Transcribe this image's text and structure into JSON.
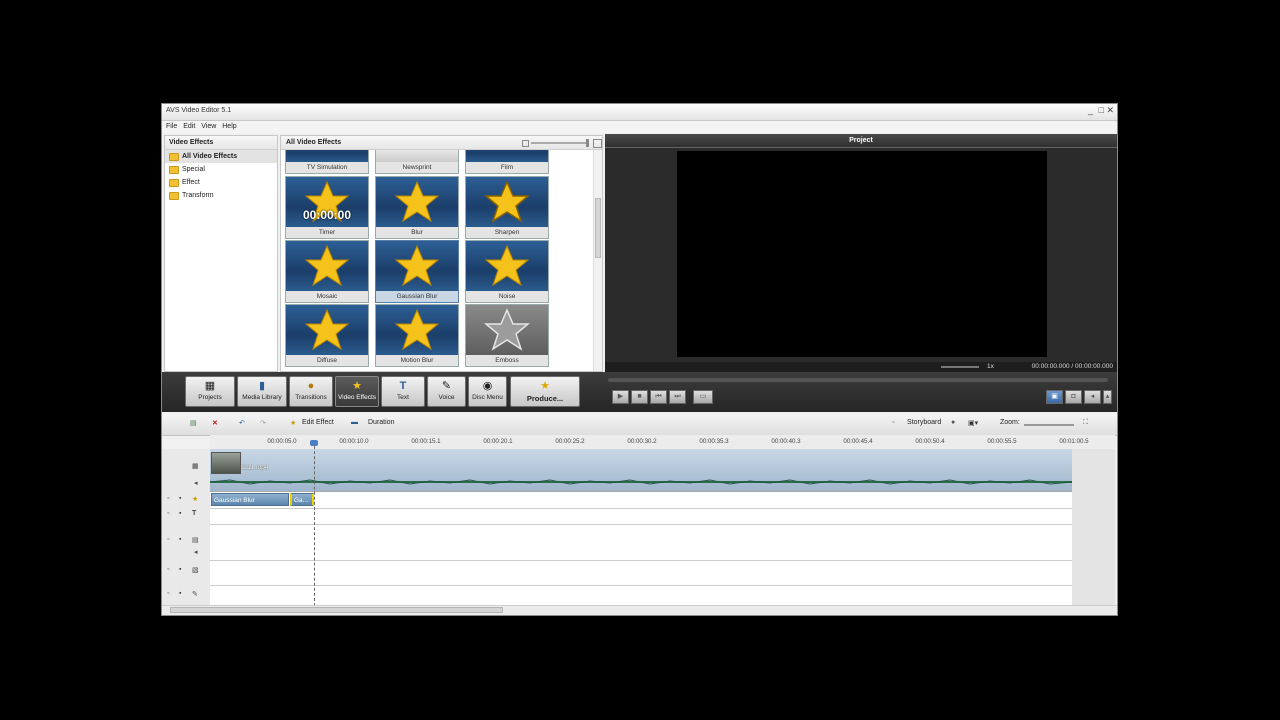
{
  "window": {
    "title": "AVS Video Editor 5.1",
    "controls": [
      "_",
      "□",
      "✕"
    ]
  },
  "menu": [
    "File",
    "Edit",
    "View",
    "Help"
  ],
  "tree": {
    "header": "Video Effects",
    "items": [
      {
        "label": "All Video Effects",
        "selected": true
      },
      {
        "label": "Special"
      },
      {
        "label": "Effect"
      },
      {
        "label": "Transform"
      }
    ]
  },
  "grid": {
    "header": "All Video Effects",
    "effects": [
      {
        "label": "TV Simulation"
      },
      {
        "label": "Newsprint"
      },
      {
        "label": "Film"
      },
      {
        "label": "Timer",
        "overlay": "00:00:00"
      },
      {
        "label": "Blur"
      },
      {
        "label": "Sharpen"
      },
      {
        "label": "Mosaic"
      },
      {
        "label": "Gaussian Blur",
        "selected": true
      },
      {
        "label": "Noise"
      },
      {
        "label": "Diffuse"
      },
      {
        "label": "Motion Blur"
      },
      {
        "label": "Emboss"
      }
    ]
  },
  "preview": {
    "title": "Project",
    "speed": "1x",
    "time": "00:00:00.000 / 00:00:00.000"
  },
  "toolbar": {
    "buttons": [
      {
        "label": "Projects",
        "icon": "projects-icon"
      },
      {
        "label": "Media Library",
        "icon": "media-library-icon"
      },
      {
        "label": "Transitions",
        "icon": "transitions-icon"
      },
      {
        "label": "Video Effects",
        "icon": "video-effects-icon",
        "active": true
      },
      {
        "label": "Text",
        "icon": "text-icon"
      },
      {
        "label": "Voice",
        "icon": "voice-icon"
      },
      {
        "label": "Disc Menu",
        "icon": "disc-menu-icon"
      },
      {
        "label": "Produce...",
        "icon": "produce-icon"
      }
    ]
  },
  "timeline": {
    "edit_effect": "Edit Effect",
    "duration": "Duration",
    "storyboard": "Storyboard",
    "zoom": "Zoom:",
    "ruler": [
      "00:00:05.0",
      "00:00:10.0",
      "00:00:15.1",
      "00:00:20.1",
      "00:00:25.2",
      "00:00:30.2",
      "00:00:35.3",
      "00:00:40.3",
      "00:00:45.4",
      "00:00:50.4",
      "00:00:55.5",
      "00:01:00.5"
    ],
    "video_clip": "1111.mp4",
    "effect_clips": [
      "Gaussian Blur",
      "Ga..."
    ]
  },
  "colors": {
    "accent": "#4d7fc4",
    "thumb_bg": "#234b7c",
    "toolbar_bg": "#2f2f2f"
  }
}
